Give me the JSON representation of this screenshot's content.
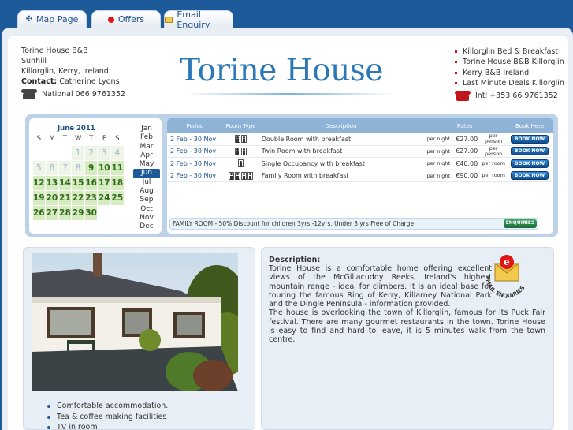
{
  "tabs": [
    {
      "label": "Map Page",
      "icon": "compass-icon"
    },
    {
      "label": "Offers",
      "icon": "red-dot-icon"
    },
    {
      "label": "Email Enquiry",
      "icon": "envelope-icon"
    }
  ],
  "header": {
    "address_lines": [
      "Torine House B&B",
      "Sunhill",
      "Killorglin, Kerry, Ireland"
    ],
    "contact_label": "Contact:",
    "contact_name": "Catherine Lyons",
    "phone_national": "National 066 9761352",
    "phone_intl": "Intl +353 66 9761352",
    "logo_text": "Torine House",
    "links": [
      "Killorglin Bed & Breakfast",
      "Torine House B&B Killorglin",
      "Kerry B&B Ireland",
      "Last Minute Deals Killorglin"
    ]
  },
  "calendar": {
    "title": "June 2011",
    "weekdays": [
      "S",
      "M",
      "T",
      "W",
      "T",
      "F",
      "S"
    ],
    "days": [
      [
        "",
        "",
        "",
        "1",
        "2",
        "3",
        "4"
      ],
      [
        "5",
        "6",
        "7",
        "8",
        "9",
        "10",
        "11"
      ],
      [
        "12",
        "13",
        "14",
        "15",
        "16",
        "17",
        "18"
      ],
      [
        "19",
        "20",
        "21",
        "22",
        "23",
        "24",
        "25"
      ],
      [
        "26",
        "27",
        "28",
        "29",
        "30",
        "",
        ""
      ]
    ],
    "months": [
      "Jan",
      "Feb",
      "Mar",
      "Apr",
      "May",
      "Jun",
      "Jul",
      "Aug",
      "Sep",
      "Oct",
      "Nov",
      "Dec"
    ],
    "selected_month": "Jun"
  },
  "rates_table": {
    "headers": [
      "Period",
      "Room Type",
      "Description",
      "Rates",
      "Book Here"
    ],
    "rows": [
      {
        "period": "2 Feb - 30 Nov",
        "guests": 2,
        "description": "Double Room with breakfast",
        "per": "per night",
        "rate": "€27.00",
        "unit": "per person",
        "book": "BOOK NOW"
      },
      {
        "period": "2 Feb - 30 Nov",
        "guests": 2,
        "description": "Twin Room with breakfast",
        "per": "per night",
        "rate": "€27.00",
        "unit": "per person",
        "book": "BOOK NOW"
      },
      {
        "period": "2 Feb - 30 Nov",
        "guests": 1,
        "description": "Single Occupancy with breakfast",
        "per": "per night",
        "rate": "€40.00",
        "unit": "per room",
        "book": "BOOK NOW"
      },
      {
        "period": "2 Feb - 30 Nov",
        "guests": 4,
        "description": "Family Room with breakfast",
        "per": "per night",
        "rate": "€90.00",
        "unit": "per room",
        "book": "BOOK NOW"
      }
    ],
    "family_note": "FAMILY ROOM - 50% Discount for children 3yrs -12yrs. Under 3 yrs Free of Charge",
    "enquiries_label": "ENQUIRIES"
  },
  "features": [
    "Comfortable accommodation.",
    "Tea & coffee making facilities",
    "TV in room"
  ],
  "description": {
    "title": "Description:",
    "para1": "Torine House is a comfortable home offering excellent views of the McGillacuddy Reeks, Ireland's highest mountain range - ideal for climbers. It is an ideal base for touring the famous Ring of Kerry, Killarney National Park and the Dingle Peninsula - information provided.",
    "para2": "The house is overlooking the town of Killorglin, famous for its Puck Fair festival. There are many gourmet restaurants in the town. Torine House is easy to find and hard to leave, it is 5 minutes walk from the town centre.",
    "badge_text": "EMAIL ENQUIRIES"
  },
  "colors": {
    "brand_blue": "#1d5a9a",
    "logo_blue": "#2a78b8",
    "accent_red": "#c0161b",
    "available_green": "#d6ebbf"
  }
}
